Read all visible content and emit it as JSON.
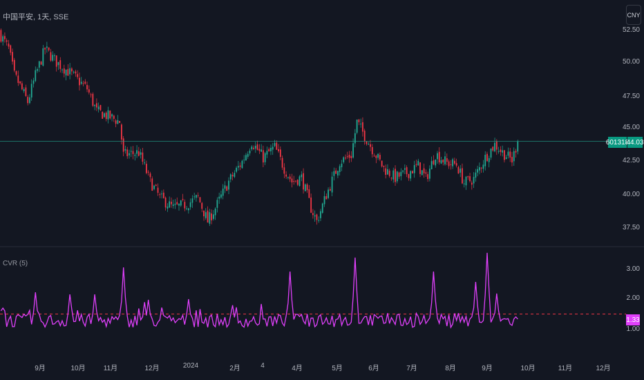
{
  "header": {
    "title": "中国平安, 1天, SSE",
    "currency_button": "CNY"
  },
  "price_axis": {
    "ticks": [
      "52.50",
      "50.00",
      "47.50",
      "45.00",
      "42.50",
      "40.00",
      "37.50"
    ]
  },
  "symbol_badge": "601318",
  "last_price": "44.03",
  "indicator": {
    "title": "CVR (5)",
    "ticks": [
      "3.00",
      "2.00",
      "1.00"
    ],
    "last_value": "1.33",
    "threshold": 1.5,
    "color": "#e040fb"
  },
  "time_axis": {
    "ticks": [
      "9月",
      "10月",
      "11月",
      "12月",
      "2024",
      "2月",
      "4",
      "4月",
      "5月",
      "6月",
      "7月",
      "8月",
      "9月",
      "10月",
      "11月",
      "12月"
    ]
  },
  "colors": {
    "up": "#22ab94",
    "down": "#f23645",
    "background": "#131722",
    "price_line": "#22ab94"
  },
  "chart_data": [
    {
      "type": "candlestick",
      "title": "中国平安, 1天, SSE",
      "ylim": [
        36.5,
        53
      ],
      "last": 44.03,
      "close_anchors": [
        [
          0,
          52
        ],
        [
          4,
          51
        ],
        [
          7,
          49
        ],
        [
          9,
          48.5
        ],
        [
          14,
          47
        ],
        [
          18,
          49
        ],
        [
          23,
          51
        ],
        [
          29,
          50
        ],
        [
          36,
          49.2
        ],
        [
          45,
          48
        ],
        [
          50,
          46.3
        ],
        [
          58,
          45.8
        ],
        [
          62,
          45.5
        ],
        [
          64,
          43
        ],
        [
          72,
          43.2
        ],
        [
          78,
          41
        ],
        [
          83,
          39.8
        ],
        [
          90,
          39
        ],
        [
          97,
          39.3
        ],
        [
          103,
          39.8
        ],
        [
          108,
          38
        ],
        [
          112,
          39
        ],
        [
          119,
          41
        ],
        [
          126,
          42.5
        ],
        [
          131,
          44
        ],
        [
          137,
          42.8
        ],
        [
          143,
          43.6
        ],
        [
          148,
          42
        ],
        [
          152,
          41
        ],
        [
          157,
          41.3
        ],
        [
          162,
          39
        ],
        [
          165,
          38
        ],
        [
          170,
          40
        ],
        [
          177,
          42.5
        ],
        [
          183,
          43
        ],
        [
          186,
          45.5
        ],
        [
          191,
          44.2
        ],
        [
          200,
          42
        ],
        [
          206,
          41.3
        ],
        [
          213,
          41.7
        ],
        [
          218,
          42.2
        ],
        [
          222,
          41.2
        ],
        [
          227,
          43.1
        ],
        [
          233,
          42.4
        ],
        [
          238,
          42.3
        ],
        [
          242,
          40.9
        ],
        [
          247,
          41.2
        ],
        [
          253,
          42.8
        ],
        [
          258,
          43.8
        ],
        [
          262,
          43.2
        ],
        [
          267,
          42.6
        ],
        [
          270,
          44.03
        ]
      ]
    },
    {
      "type": "line",
      "title": "CVR (5)",
      "ylim": [
        0.7,
        3.8
      ],
      "threshold": 1.5,
      "spikes": [
        [
          18,
          2.23
        ],
        [
          36,
          2.16
        ],
        [
          49,
          2.16
        ],
        [
          64,
          3.07
        ],
        [
          75,
          1.9
        ],
        [
          77,
          1.98
        ],
        [
          98,
          2.0
        ],
        [
          151,
          2.93
        ],
        [
          185,
          3.4
        ],
        [
          226,
          2.93
        ],
        [
          248,
          2.58
        ],
        [
          254,
          3.56
        ],
        [
          259,
          2.19
        ]
      ],
      "last": 1.33
    }
  ]
}
